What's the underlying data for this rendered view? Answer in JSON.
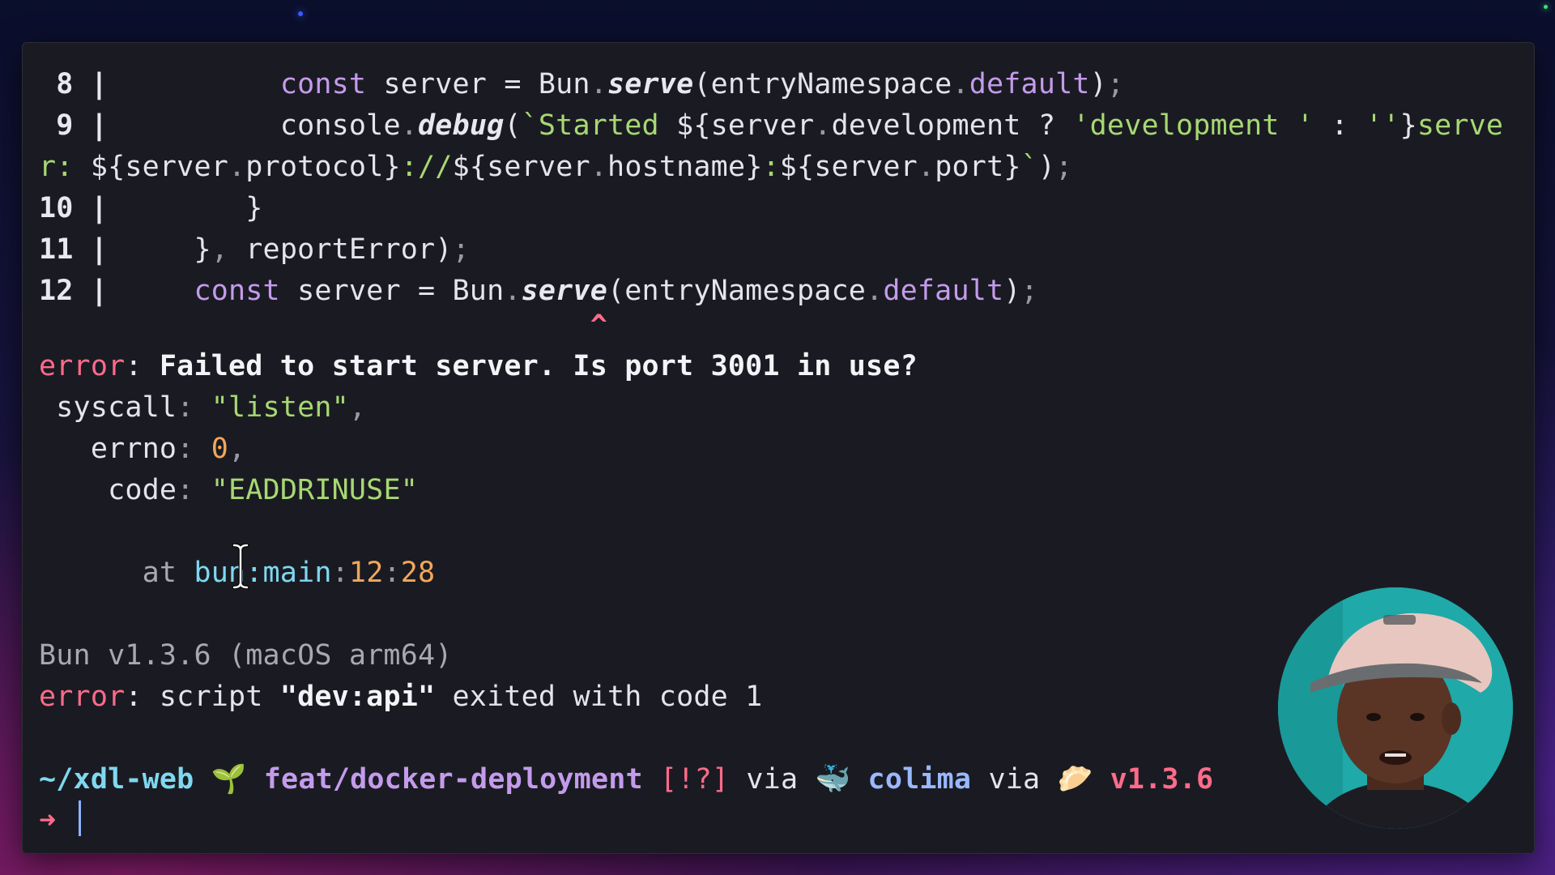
{
  "code_lines": [
    {
      "num": " 8",
      "indent": "         ",
      "tokens": [
        [
          "kw",
          "const"
        ],
        [
          "plain",
          " server = Bun"
        ],
        [
          "punc",
          "."
        ],
        [
          "fn",
          "serve"
        ],
        [
          "plain",
          "(entryNamespace"
        ],
        [
          "punc",
          "."
        ],
        [
          "prop",
          "default"
        ],
        [
          "plain",
          ")"
        ],
        [
          "punc",
          ";"
        ]
      ]
    },
    {
      "num": " 9",
      "indent": "         ",
      "tokens": [
        [
          "plain",
          "console"
        ],
        [
          "punc",
          "."
        ],
        [
          "fn",
          "debug"
        ],
        [
          "plain",
          "("
        ],
        [
          "str",
          "`Started "
        ],
        [
          "plain",
          "${server"
        ],
        [
          "punc",
          "."
        ],
        [
          "plain",
          "development ? "
        ],
        [
          "str",
          "'development '"
        ],
        [
          "plain",
          " : "
        ],
        [
          "str",
          "''"
        ],
        [
          "plain",
          "}"
        ],
        [
          "str",
          "serve"
        ]
      ]
    },
    {
      "num": "",
      "indent": "",
      "tokens": [
        [
          "str",
          "r: "
        ],
        [
          "plain",
          "${server"
        ],
        [
          "punc",
          "."
        ],
        [
          "plain",
          "protocol}"
        ],
        [
          "str",
          "://"
        ],
        [
          "plain",
          "${server"
        ],
        [
          "punc",
          "."
        ],
        [
          "plain",
          "hostname}"
        ],
        [
          "str",
          ":"
        ],
        [
          "plain",
          "${server"
        ],
        [
          "punc",
          "."
        ],
        [
          "plain",
          "port}"
        ],
        [
          "str",
          "`"
        ],
        [
          "plain",
          ")"
        ],
        [
          "punc",
          ";"
        ]
      ]
    },
    {
      "num": "10",
      "indent": "       ",
      "tokens": [
        [
          "plain",
          "}"
        ]
      ]
    },
    {
      "num": "11",
      "indent": "    ",
      "tokens": [
        [
          "plain",
          "}"
        ],
        [
          "punc",
          ","
        ],
        [
          "plain",
          " reportError)"
        ],
        [
          "punc",
          ";"
        ]
      ]
    },
    {
      "num": "12",
      "indent": "    ",
      "tokens": [
        [
          "kw",
          "const"
        ],
        [
          "plain",
          " server = Bun"
        ],
        [
          "punc",
          "."
        ],
        [
          "fn",
          "serve"
        ],
        [
          "plain",
          "(entryNamespace"
        ],
        [
          "punc",
          "."
        ],
        [
          "prop",
          "default"
        ],
        [
          "plain",
          ")"
        ],
        [
          "punc",
          ";"
        ]
      ]
    }
  ],
  "line_sep": " | ",
  "caret_line": "                                ^",
  "error_main": {
    "label": "error",
    "colon": ": ",
    "message": "Failed to start server. Is port 3001 in use?"
  },
  "error_fields": [
    {
      "indent": " ",
      "key": "syscall",
      "value": "\"listen\"",
      "value_type": "str",
      "trail": ","
    },
    {
      "indent": "   ",
      "key": "errno",
      "value": "0",
      "value_type": "num",
      "trail": ","
    },
    {
      "indent": "    ",
      "key": "code",
      "value": "\"EADDRINUSE\"",
      "value_type": "str",
      "trail": ""
    }
  ],
  "stack": {
    "indent": "      ",
    "at": "at ",
    "location": "bun:main",
    "line": "12",
    "col": "28"
  },
  "bun_version_line": "Bun v1.3.6 (macOS arm64)",
  "script_error": {
    "label": "error",
    "colon": ": ",
    "pre": "script ",
    "script_name": "\"dev:api\"",
    "post": " exited with code 1"
  },
  "prompt": {
    "dir": "~/xdl-web",
    "branch_emoji": "🌱",
    "branch": "feat/docker-deployment",
    "status": "[!?]",
    "via1": "via",
    "docker_emoji": "🐳",
    "docker_ctx": "colima",
    "via2": "via",
    "bun_emoji": "🥟",
    "bun_version": "v1.3.6",
    "arrow": "➜"
  },
  "colors": {
    "terminal_bg": "#1a1b22",
    "error": "#ff6b8a",
    "string": "#a7d873",
    "keyword": "#c49bec",
    "number": "#f2a65a",
    "cyan": "#7fd8f0"
  }
}
